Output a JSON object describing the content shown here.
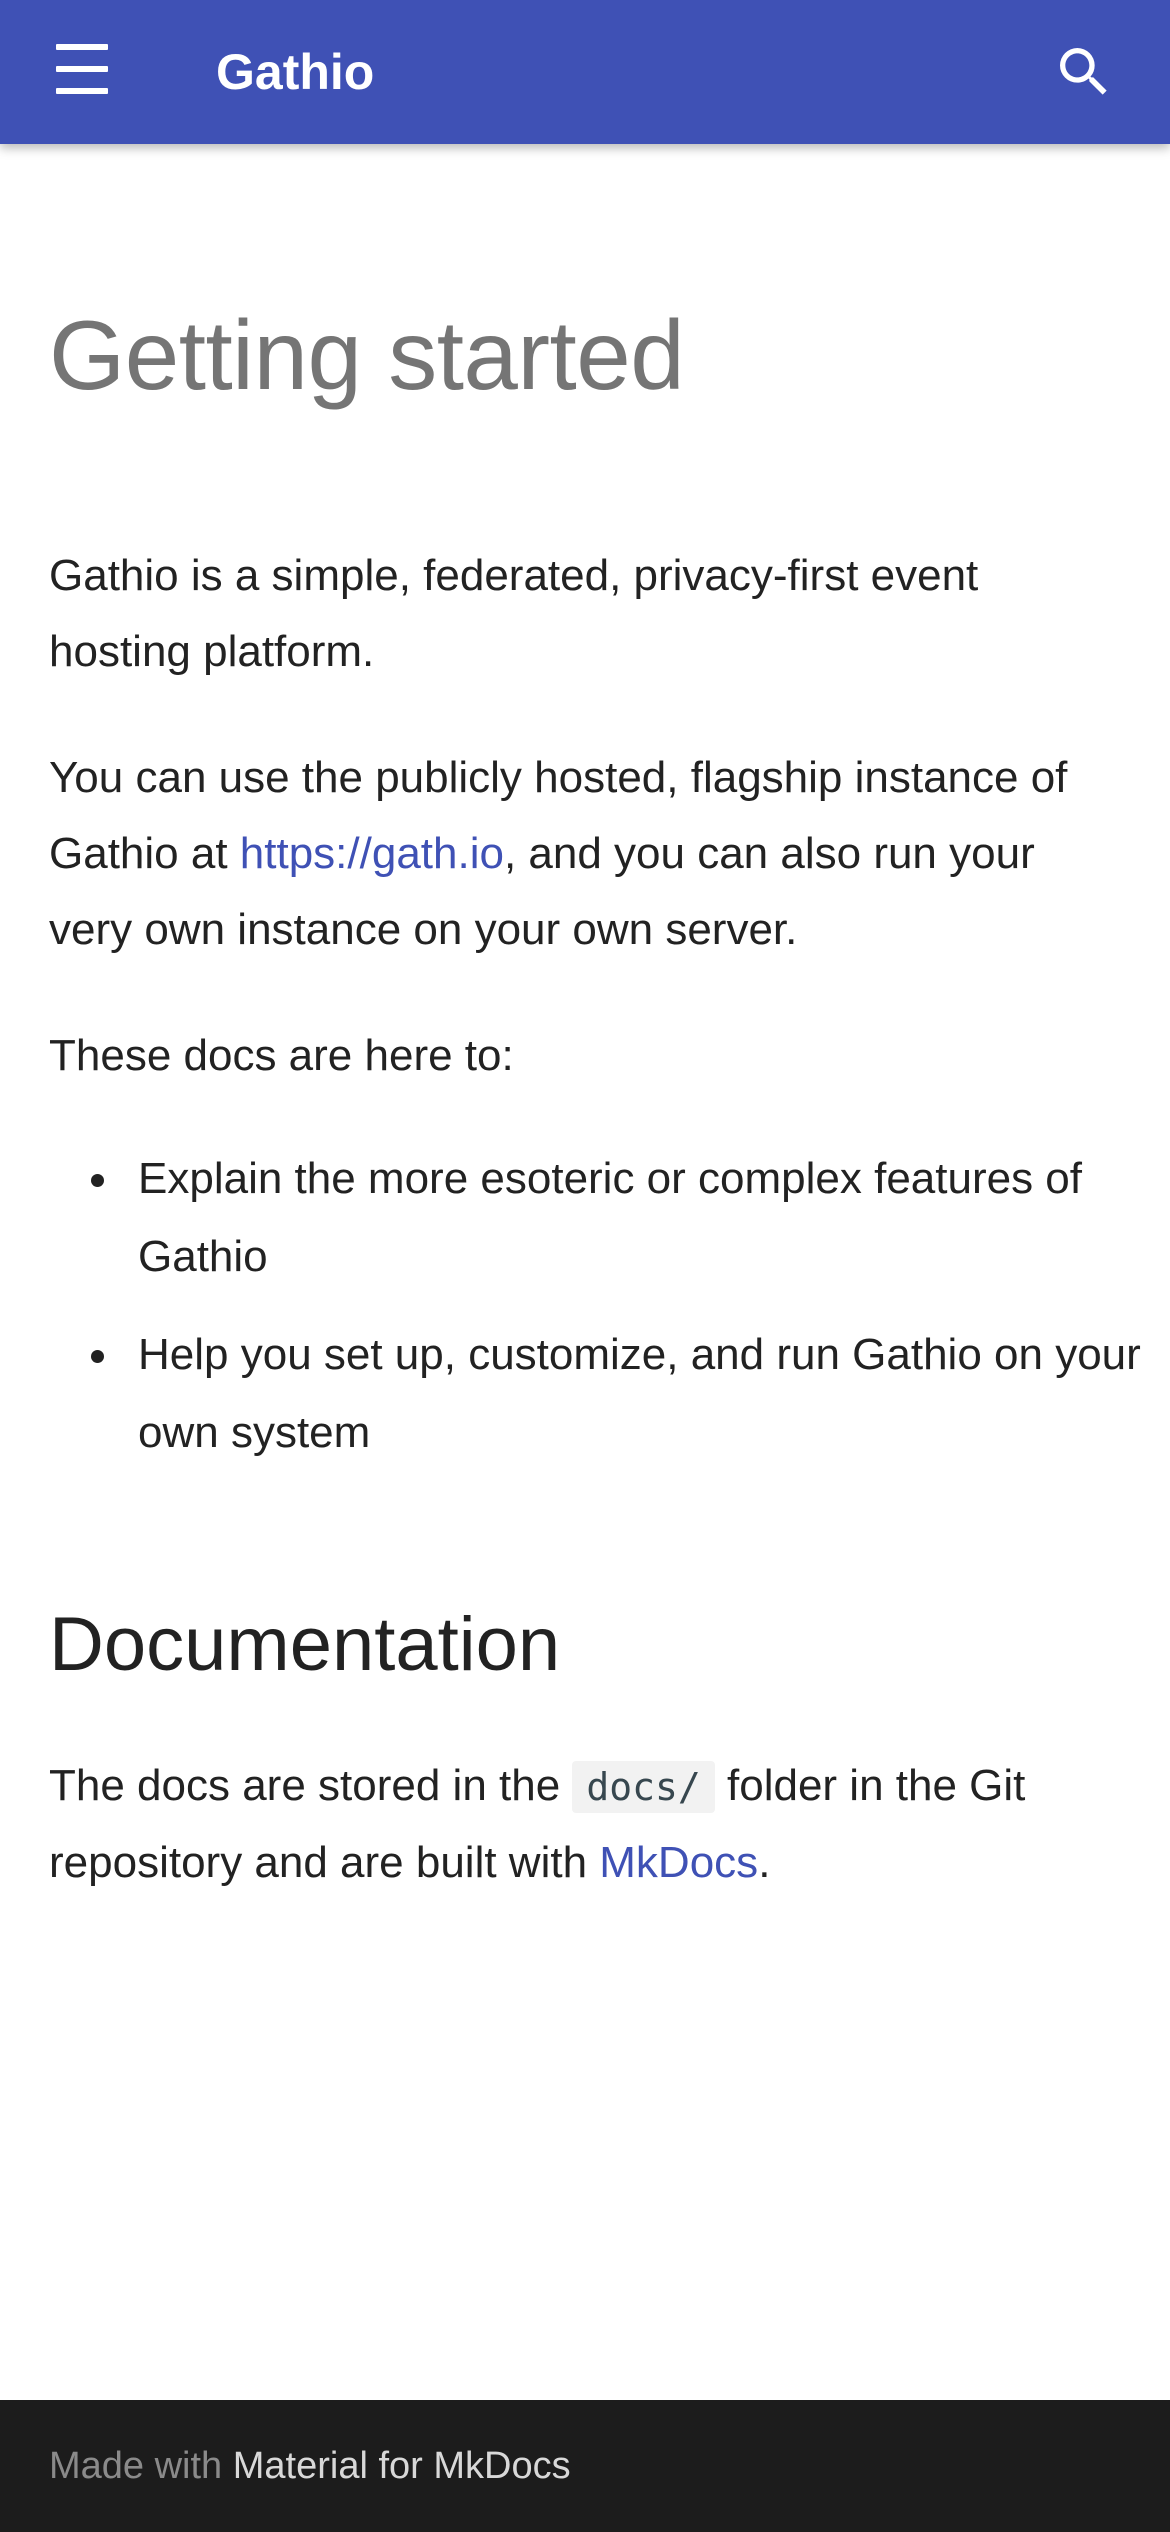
{
  "header": {
    "title": "Gathio",
    "menu_icon": "hamburger-menu-icon",
    "search_icon": "search-icon"
  },
  "main": {
    "page_title": "Getting started",
    "intro": "Gathio is a simple, federated, privacy-first event hosting platform.",
    "usage_prefix": "You can use the publicly hosted, flagship instance of Gathio at ",
    "usage_link": "https://gath.io",
    "usage_suffix": ", and you can also run your very own instance on your own server.",
    "docs_intro": "These docs are here to:",
    "features": [
      "Explain the more esoteric or complex features of Gathio",
      "Help you set up, customize, and run Gathio on your own system"
    ],
    "documentation_heading": "Documentation",
    "docs_prefix": "The docs are stored in the ",
    "docs_code": "docs/",
    "docs_middle": " folder in the Git repository and are built with ",
    "docs_link": "MkDocs",
    "docs_suffix": "."
  },
  "footer": {
    "made_with": "Made with",
    "material_link": "Material for MkDocs"
  },
  "colors": {
    "primary": "#3f51b5",
    "footer_bg": "#1c1c1c",
    "title_gray": "#757575"
  }
}
